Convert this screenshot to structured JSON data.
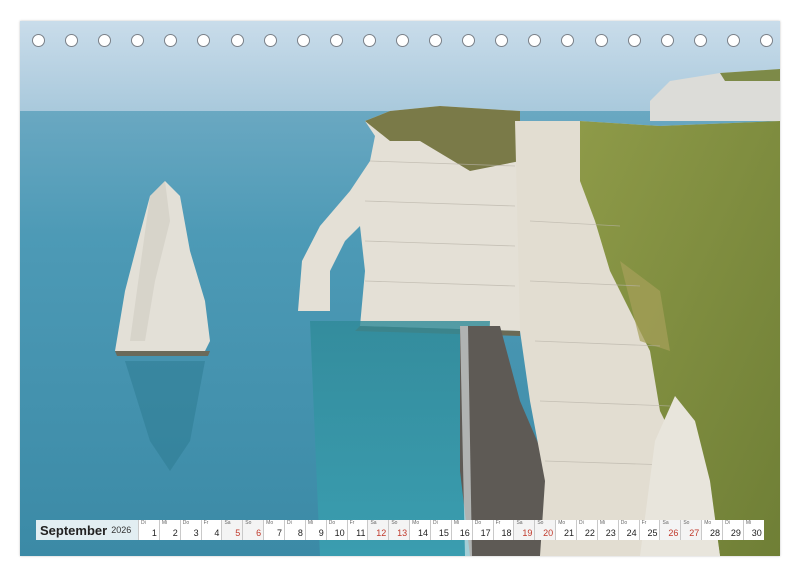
{
  "calendar": {
    "month": "September",
    "year": "2026",
    "days": [
      {
        "n": "1",
        "dow": "Di",
        "we": false
      },
      {
        "n": "2",
        "dow": "Mi",
        "we": false
      },
      {
        "n": "3",
        "dow": "Do",
        "we": false
      },
      {
        "n": "4",
        "dow": "Fr",
        "we": false
      },
      {
        "n": "5",
        "dow": "Sa",
        "we": true
      },
      {
        "n": "6",
        "dow": "So",
        "we": true
      },
      {
        "n": "7",
        "dow": "Mo",
        "we": false
      },
      {
        "n": "8",
        "dow": "Di",
        "we": false
      },
      {
        "n": "9",
        "dow": "Mi",
        "we": false
      },
      {
        "n": "10",
        "dow": "Do",
        "we": false
      },
      {
        "n": "11",
        "dow": "Fr",
        "we": false
      },
      {
        "n": "12",
        "dow": "Sa",
        "we": true
      },
      {
        "n": "13",
        "dow": "So",
        "we": true
      },
      {
        "n": "14",
        "dow": "Mo",
        "we": false
      },
      {
        "n": "15",
        "dow": "Di",
        "we": false
      },
      {
        "n": "16",
        "dow": "Mi",
        "we": false
      },
      {
        "n": "17",
        "dow": "Do",
        "we": false
      },
      {
        "n": "18",
        "dow": "Fr",
        "we": false
      },
      {
        "n": "19",
        "dow": "Sa",
        "we": true
      },
      {
        "n": "20",
        "dow": "So",
        "we": true
      },
      {
        "n": "21",
        "dow": "Mo",
        "we": false
      },
      {
        "n": "22",
        "dow": "Di",
        "we": false
      },
      {
        "n": "23",
        "dow": "Mi",
        "we": false
      },
      {
        "n": "24",
        "dow": "Do",
        "we": false
      },
      {
        "n": "25",
        "dow": "Fr",
        "we": false
      },
      {
        "n": "26",
        "dow": "Sa",
        "we": true
      },
      {
        "n": "27",
        "dow": "So",
        "we": true
      },
      {
        "n": "28",
        "dow": "Mo",
        "we": false
      },
      {
        "n": "29",
        "dow": "Di",
        "we": false
      },
      {
        "n": "30",
        "dow": "Mi",
        "we": false
      }
    ]
  },
  "colors": {
    "sea": "#3d8fa8",
    "sky": "#cfe1ee",
    "cliff": "#e6e2d8",
    "grass": "#7f8d3d",
    "beach": "#5a5650",
    "weekend": "#c0392b"
  },
  "binding_hole_count": 23
}
